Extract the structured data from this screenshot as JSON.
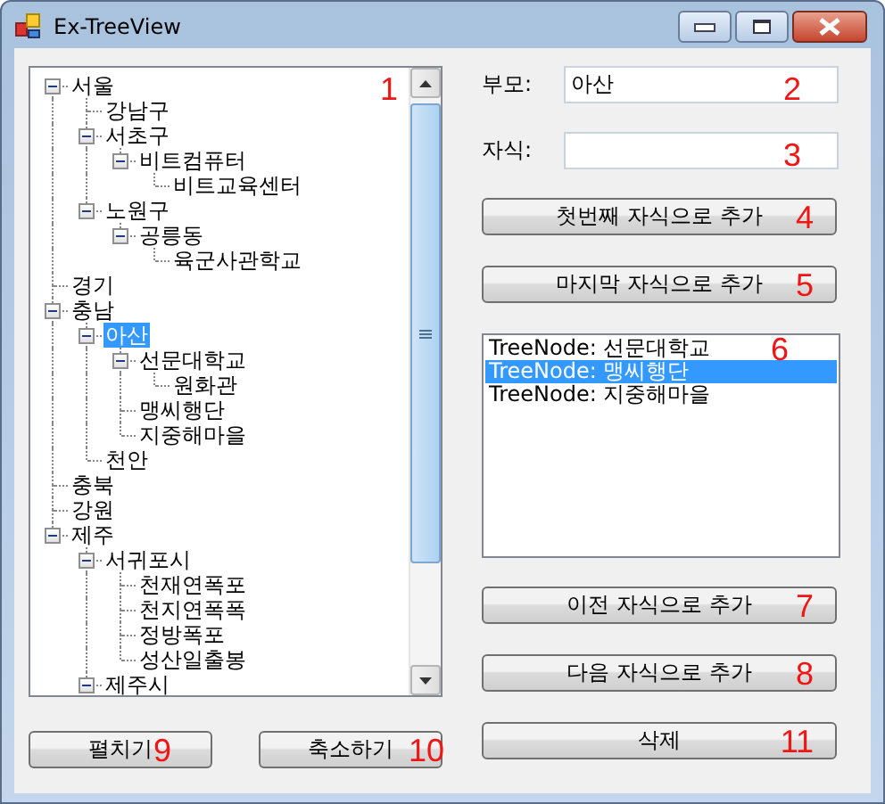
{
  "window": {
    "title": "Ex-TreeView"
  },
  "tree": {
    "annotation": "1",
    "nodes": [
      {
        "label": "서울",
        "selected": false,
        "expanded": true,
        "children": [
          {
            "label": "강남구",
            "selected": false,
            "expanded": false
          },
          {
            "label": "서초구",
            "selected": false,
            "expanded": true,
            "children": [
              {
                "label": "비트컴퓨터",
                "selected": false,
                "expanded": true,
                "children": [
                  {
                    "label": "비트교육센터",
                    "selected": false,
                    "expanded": false
                  }
                ]
              }
            ]
          },
          {
            "label": "노원구",
            "selected": false,
            "expanded": true,
            "children": [
              {
                "label": "공릉동",
                "selected": false,
                "expanded": true,
                "children": [
                  {
                    "label": "육군사관학교",
                    "selected": false,
                    "expanded": false
                  }
                ]
              }
            ]
          }
        ]
      },
      {
        "label": "경기",
        "selected": false,
        "expanded": false
      },
      {
        "label": "충남",
        "selected": false,
        "expanded": true,
        "children": [
          {
            "label": "아산",
            "selected": true,
            "expanded": true,
            "children": [
              {
                "label": "선문대학교",
                "selected": false,
                "expanded": true,
                "children": [
                  {
                    "label": "원화관",
                    "selected": false,
                    "expanded": false
                  }
                ]
              },
              {
                "label": "맹씨행단",
                "selected": false,
                "expanded": false
              },
              {
                "label": "지중해마을",
                "selected": false,
                "expanded": false
              }
            ]
          },
          {
            "label": "천안",
            "selected": false,
            "expanded": false
          }
        ]
      },
      {
        "label": "충북",
        "selected": false,
        "expanded": false
      },
      {
        "label": "강원",
        "selected": false,
        "expanded": false
      },
      {
        "label": "제주",
        "selected": false,
        "expanded": true,
        "children": [
          {
            "label": "서귀포시",
            "selected": false,
            "expanded": true,
            "children": [
              {
                "label": "천재연폭포",
                "selected": false,
                "expanded": false
              },
              {
                "label": "천지연폭폭",
                "selected": false,
                "expanded": false
              },
              {
                "label": "정방폭포",
                "selected": false,
                "expanded": false
              },
              {
                "label": "성산일출봉",
                "selected": false,
                "expanded": false
              }
            ]
          },
          {
            "label": "제주시",
            "selected": false,
            "expanded": true
          }
        ]
      }
    ]
  },
  "fields": [
    {
      "label": "부모:",
      "value": "아산",
      "annotation": "2"
    },
    {
      "label": "자식:",
      "annotation": "3"
    }
  ],
  "top_buttons": [
    {
      "label": "첫번째 자식으로 추가",
      "annotation": "4"
    },
    {
      "label": "마지막 자식으로 추가",
      "annotation": "5"
    }
  ],
  "listbox": {
    "annotation": "6",
    "items": [
      {
        "text": "TreeNode: 선문대학교",
        "selected": false
      },
      {
        "text": "TreeNode: 맹씨행단",
        "selected": true
      },
      {
        "text": "TreeNode: 지중해마을",
        "selected": false
      }
    ]
  },
  "bottom_buttons": [
    {
      "label": "이전 자식으로 추가",
      "annotation": "7"
    },
    {
      "label": "다음 자식으로 추가",
      "annotation": "8"
    }
  ],
  "left_buttons": [
    {
      "label": "펼치기",
      "annotation": "9"
    },
    {
      "label": "축소하기",
      "annotation": "10"
    }
  ],
  "delete_button": {
    "label": "삭제",
    "annotation": "11"
  }
}
